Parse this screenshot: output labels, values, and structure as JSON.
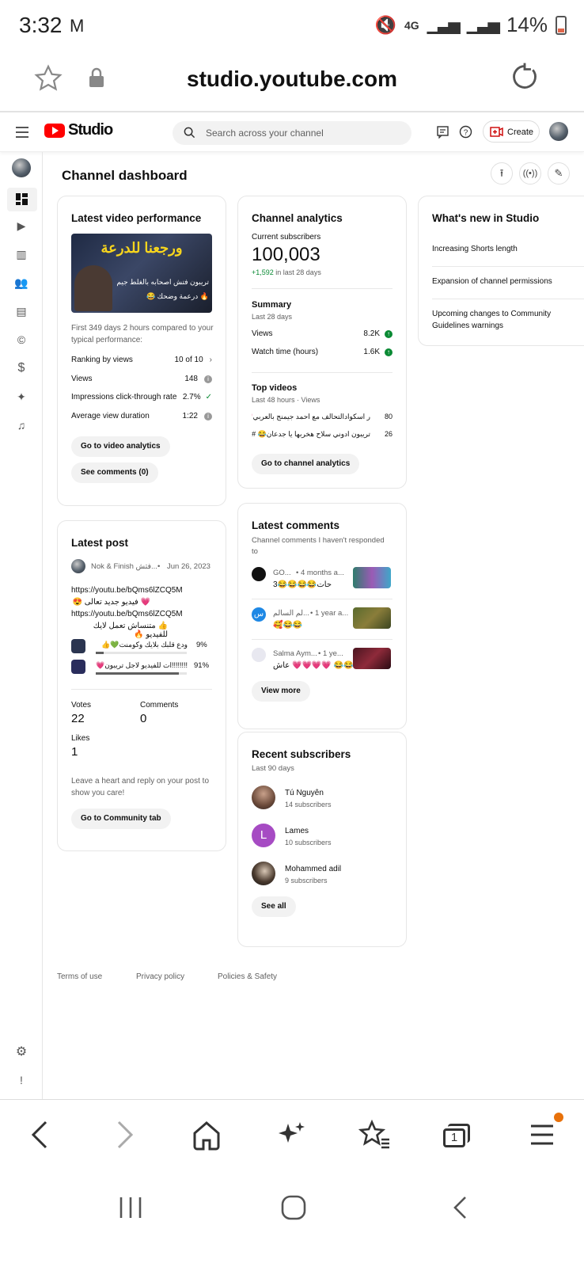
{
  "status_bar": {
    "time": "3:32",
    "mail_glyph": "M",
    "network": "4G",
    "battery": "14%"
  },
  "browser": {
    "url": "studio.youtube.com"
  },
  "header": {
    "brand": "Studio",
    "search_placeholder": "Search across your channel",
    "create_label": "Create"
  },
  "dashboard": {
    "title": "Channel dashboard"
  },
  "latest_video": {
    "title": "Latest video performance",
    "thumb_title": "ورجعنا للدرعة",
    "thumb_sub1": "تريبون فتش اصحابه بالغلط جيم",
    "thumb_sub2": "🔥 درعمة وضحك 😂",
    "compare_text_1": "First 349 days 2 hours compared to your",
    "compare_text_2": "typical performance:",
    "stats": [
      {
        "label": "Ranking by views",
        "value": "10 of 10"
      },
      {
        "label": "Views",
        "value": "148"
      },
      {
        "label": "Impressions click-through rate",
        "value": "2.7%"
      },
      {
        "label": "Average view duration",
        "value": "1:22"
      }
    ],
    "btn_analytics": "Go to video analytics",
    "btn_comments": "See comments (0)"
  },
  "channel_analytics": {
    "title": "Channel analytics",
    "subs_label": "Current subscribers",
    "subs_value": "100,003",
    "subs_delta": "+1,592",
    "subs_delta_suffix": " in last 28 days",
    "summary_title": "Summary",
    "summary_period": "Last 28 days",
    "summary": [
      {
        "label": "Views",
        "value": "8.2K"
      },
      {
        "label": "Watch time (hours)",
        "value": "1.6K"
      }
    ],
    "top_title": "Top videos",
    "top_period": "Last 48 hours · Views",
    "top_videos": [
      {
        "title": "ر اسكوادالتحالف مع احمد جيمنج بالعربي💗",
        "views": "80"
      },
      {
        "title": "تريبون ادوني سلاح هخربها يا جدعان😂 #p...",
        "views": "26"
      }
    ],
    "btn": "Go to channel analytics"
  },
  "whats_new": {
    "title": "What's new in Studio",
    "items": [
      "Increasing Shorts length",
      "Expansion of channel permissions",
      "Upcoming changes to Community",
      "Guidelines warnings"
    ]
  },
  "latest_post": {
    "title": "Latest post",
    "author": "Nok & Finish فتش...",
    "date": "Jun 26, 2023",
    "lines": [
      "https://youtu.be/bQms6lZCQ5M",
      "💗 فيديو جديد تعالى 😍",
      "https://youtu.be/bQms6lZCQ5M",
      "👍 متنساش تعمل لايك للفيديو 🔥"
    ],
    "poll": [
      {
        "text": "ودع قلبك بلايك وكومنت💚👍",
        "pct": "9%",
        "fill": 0.09
      },
      {
        "text": "!!!!!!!!ات للفيديو لاجل تريبون💗",
        "pct": "91%",
        "fill": 0.91
      }
    ],
    "votes_label": "Votes",
    "votes": "22",
    "comments_label": "Comments",
    "comments": "0",
    "likes_label": "Likes",
    "likes": "1",
    "footer_1": "Leave a heart and reply on your post to",
    "footer_2": "show you care!",
    "btn": "Go to Community tab"
  },
  "latest_comments": {
    "title": "Latest comments",
    "subtitle_1": "Channel comments I haven't responded",
    "subtitle_2": "to",
    "items": [
      {
        "author": "GO...",
        "time": "• 4 months a...",
        "text": "حات😂😂😂😂3",
        "initial": ""
      },
      {
        "author": "لم السالم...",
        "time": "• 1 year a...",
        "text": "🥰😂😂",
        "initial": "س"
      },
      {
        "author": "Salma Aym...",
        "time": "• 1 ye...",
        "text": "عاش 💗💗💗💗 😂😂",
        "initial": ""
      }
    ],
    "btn": "View more"
  },
  "recent_subscribers": {
    "title": "Recent subscribers",
    "period": "Last 90 days",
    "items": [
      {
        "name": "Tú Nguyên",
        "subs": "14 subscribers",
        "initial": ""
      },
      {
        "name": "Lames",
        "subs": "10 subscribers",
        "initial": "L"
      },
      {
        "name": "Mohammed adil",
        "subs": "9 subscribers",
        "initial": ""
      }
    ],
    "btn": "See all"
  },
  "footer": {
    "terms": "Terms of use",
    "privacy": "Privacy policy",
    "policies": "Policies & Safety"
  },
  "bottom_nav": {
    "tabs_count": "1"
  },
  "colors": {
    "accent": "#ff0000",
    "positive": "#0a8a34",
    "badge": "#e8710a",
    "lames_avatar": "#a64bc3",
    "s_avatar": "#1e88e5"
  }
}
